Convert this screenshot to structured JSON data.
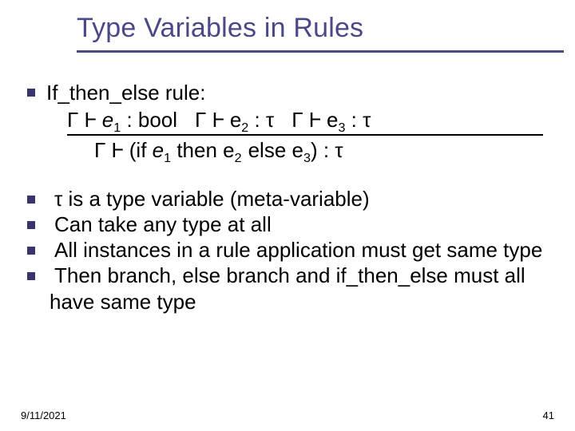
{
  "title": "Type Variables in Rules",
  "rule": {
    "heading": "If_then_else rule:",
    "premises_html": "Γ Ⱶ <span class=\"it\">e</span><sub>1</sub> : bool<span class=\"gap1\"></span>Γ Ⱶ e<sub>2</sub> : τ<span class=\"gap2\"></span>Γ Ⱶ e<sub>3</sub> : τ",
    "conclusion_html": "Γ Ⱶ (if <span class=\"it\">e</span><sub>1</sub> then e<sub>2</sub><span class=\"tspace\"></span>else e<sub>3</sub>) : τ"
  },
  "points": [
    "τ is a type variable (meta-variable)",
    "Can take any type at all",
    "All instances in a rule application must get same type",
    "Then branch, else branch and if_then_else must all have same type"
  ],
  "footer": {
    "date": "9/11/2021",
    "page": "41"
  }
}
